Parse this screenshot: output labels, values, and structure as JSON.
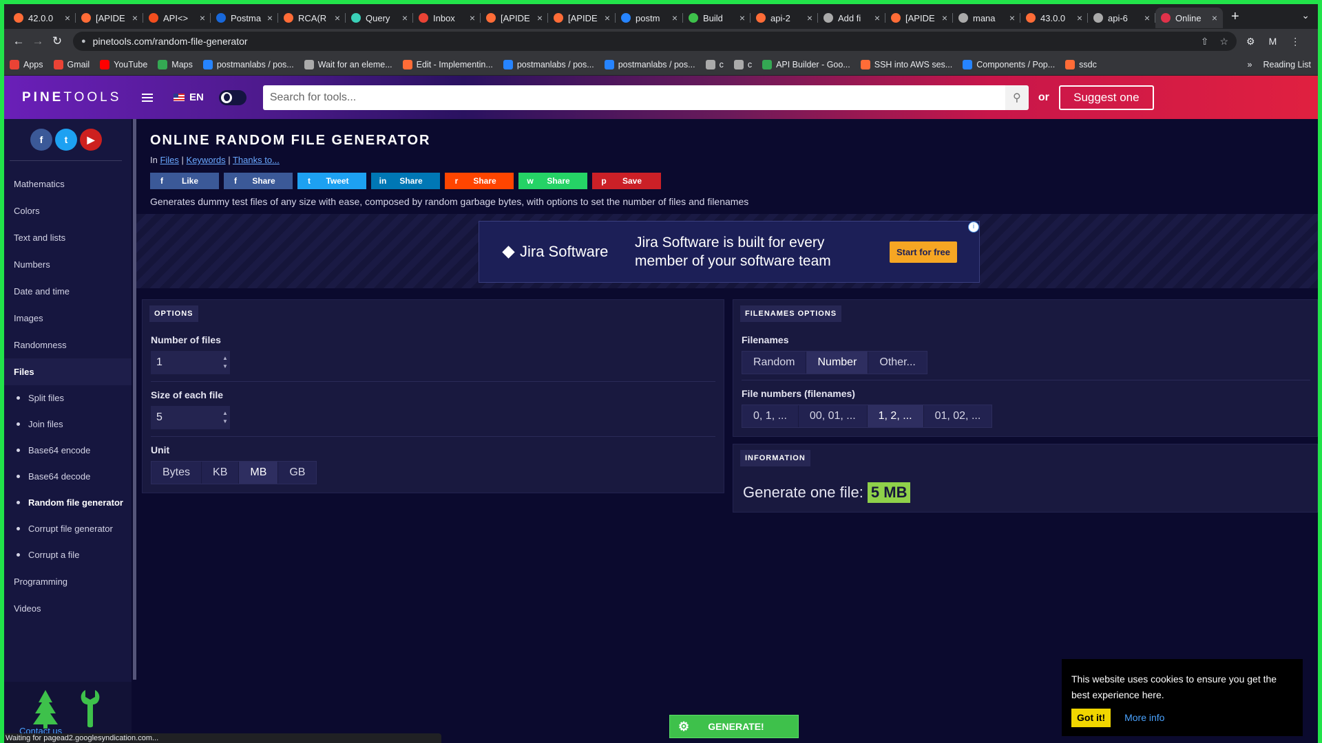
{
  "tabs": [
    {
      "label": "42.0.0",
      "color": "#ff6c37"
    },
    {
      "label": "[APIDE",
      "color": "#ff6c37"
    },
    {
      "label": "API<>",
      "color": "#f24e1e"
    },
    {
      "label": "Postma",
      "color": "#1868db"
    },
    {
      "label": "RCA(R",
      "color": "#ff6c37"
    },
    {
      "label": "Query",
      "color": "#3ad0b8"
    },
    {
      "label": "Inbox",
      "color": "#ea4335"
    },
    {
      "label": "[APIDE",
      "color": "#ff6c37"
    },
    {
      "label": "[APIDE",
      "color": "#ff6c37"
    },
    {
      "label": "postm",
      "color": "#2684ff"
    },
    {
      "label": "Build",
      "color": "#3ec14b"
    },
    {
      "label": "api-2",
      "color": "#ff6c37"
    },
    {
      "label": "Add fi",
      "color": "#aaaaaa"
    },
    {
      "label": "[APIDE",
      "color": "#ff6c37"
    },
    {
      "label": "mana",
      "color": "#aaaaaa"
    },
    {
      "label": "43.0.0",
      "color": "#ff6c37"
    },
    {
      "label": "api-6",
      "color": "#aaaaaa"
    },
    {
      "label": "Online",
      "color": "#e0324a",
      "active": true
    }
  ],
  "browser": {
    "url": "pinetools.com/random-file-generator",
    "profile_letter": "M",
    "reading_list": "Reading List",
    "status": "Waiting for pagead2.googlesyndication.com..."
  },
  "bookmarks": [
    {
      "label": "Apps",
      "color": "#ea4335"
    },
    {
      "label": "Gmail",
      "color": "#ea4335"
    },
    {
      "label": "YouTube",
      "color": "#ff0000"
    },
    {
      "label": "Maps",
      "color": "#34a853"
    },
    {
      "label": "postmanlabs / pos...",
      "color": "#2684ff"
    },
    {
      "label": "Wait for an eleme...",
      "color": "#aaaaaa"
    },
    {
      "label": "Edit - Implementin...",
      "color": "#ff6c37"
    },
    {
      "label": "postmanlabs / pos...",
      "color": "#2684ff"
    },
    {
      "label": "postmanlabs / pos...",
      "color": "#2684ff"
    },
    {
      "label": "c",
      "color": "#aaaaaa"
    },
    {
      "label": "c",
      "color": "#aaaaaa"
    },
    {
      "label": "API Builder - Goo...",
      "color": "#34a853"
    },
    {
      "label": "SSH into AWS ses...",
      "color": "#ff6c37"
    },
    {
      "label": "Components / Pop...",
      "color": "#2684ff"
    },
    {
      "label": "ssdc",
      "color": "#ff6c37"
    }
  ],
  "header": {
    "logo_bold": "PINE",
    "logo_light": "TOOLS",
    "lang": "EN",
    "search_placeholder": "Search for tools...",
    "or": "or",
    "suggest": "Suggest one"
  },
  "sidebar": {
    "categories": [
      "Mathematics",
      "Colors",
      "Text and lists",
      "Numbers",
      "Date and time",
      "Images",
      "Randomness"
    ],
    "active": "Files",
    "subitems": [
      "Split files",
      "Join files",
      "Base64 encode",
      "Base64 decode",
      "Random file generator",
      "Corrupt file generator",
      "Corrupt a file"
    ],
    "current_subitem": "Random file generator",
    "after": [
      "Programming",
      "Videos"
    ],
    "contact": "Contact us"
  },
  "page": {
    "title": "ONLINE RANDOM FILE GENERATOR",
    "crumb_prefix": "In",
    "crumb_files": "Files",
    "crumb_keywords": "Keywords",
    "crumb_thanks": "Thanks to...",
    "description": "Generates dummy test files of any size with ease, composed by random garbage bytes, with options to set the number of files and filenames"
  },
  "shares": [
    {
      "label": "Like",
      "icon": "f",
      "color": "#3b5998"
    },
    {
      "label": "Share",
      "icon": "f",
      "color": "#3b5998"
    },
    {
      "label": "Tweet",
      "icon": "t",
      "color": "#1da1f2"
    },
    {
      "label": "Share",
      "icon": "in",
      "color": "#0077b5"
    },
    {
      "label": "Share",
      "icon": "r",
      "color": "#ff4500"
    },
    {
      "label": "Share",
      "icon": "w",
      "color": "#25d366"
    },
    {
      "label": "Save",
      "icon": "p",
      "color": "#cb2027"
    }
  ],
  "ad": {
    "brand": "Jira Software",
    "text": "Jira Software is built for every member of your software team",
    "cta": "Start for free"
  },
  "options": {
    "label": "OPTIONS",
    "num_files_label": "Number of files",
    "num_files": "1",
    "size_label": "Size of each file",
    "size": "5",
    "unit_label": "Unit",
    "units": [
      "Bytes",
      "KB",
      "MB",
      "GB"
    ],
    "unit_selected": "MB"
  },
  "filenames": {
    "label": "FILENAMES OPTIONS",
    "filenames_label": "Filenames",
    "modes": [
      "Random",
      "Number",
      "Other..."
    ],
    "mode_selected": "Number",
    "numbers_label": "File numbers (filenames)",
    "formats": [
      "0, 1, ...",
      "00, 01, ...",
      "1, 2, ...",
      "01, 02, ..."
    ],
    "format_selected": "1, 2, ..."
  },
  "information": {
    "label": "INFORMATION",
    "text": "Generate one file:",
    "value": "5 MB"
  },
  "generate": "GENERATE!",
  "cookie": {
    "text": "This website uses cookies to ensure you get the best experience here.",
    "got": "Got it!",
    "more": "More info"
  }
}
